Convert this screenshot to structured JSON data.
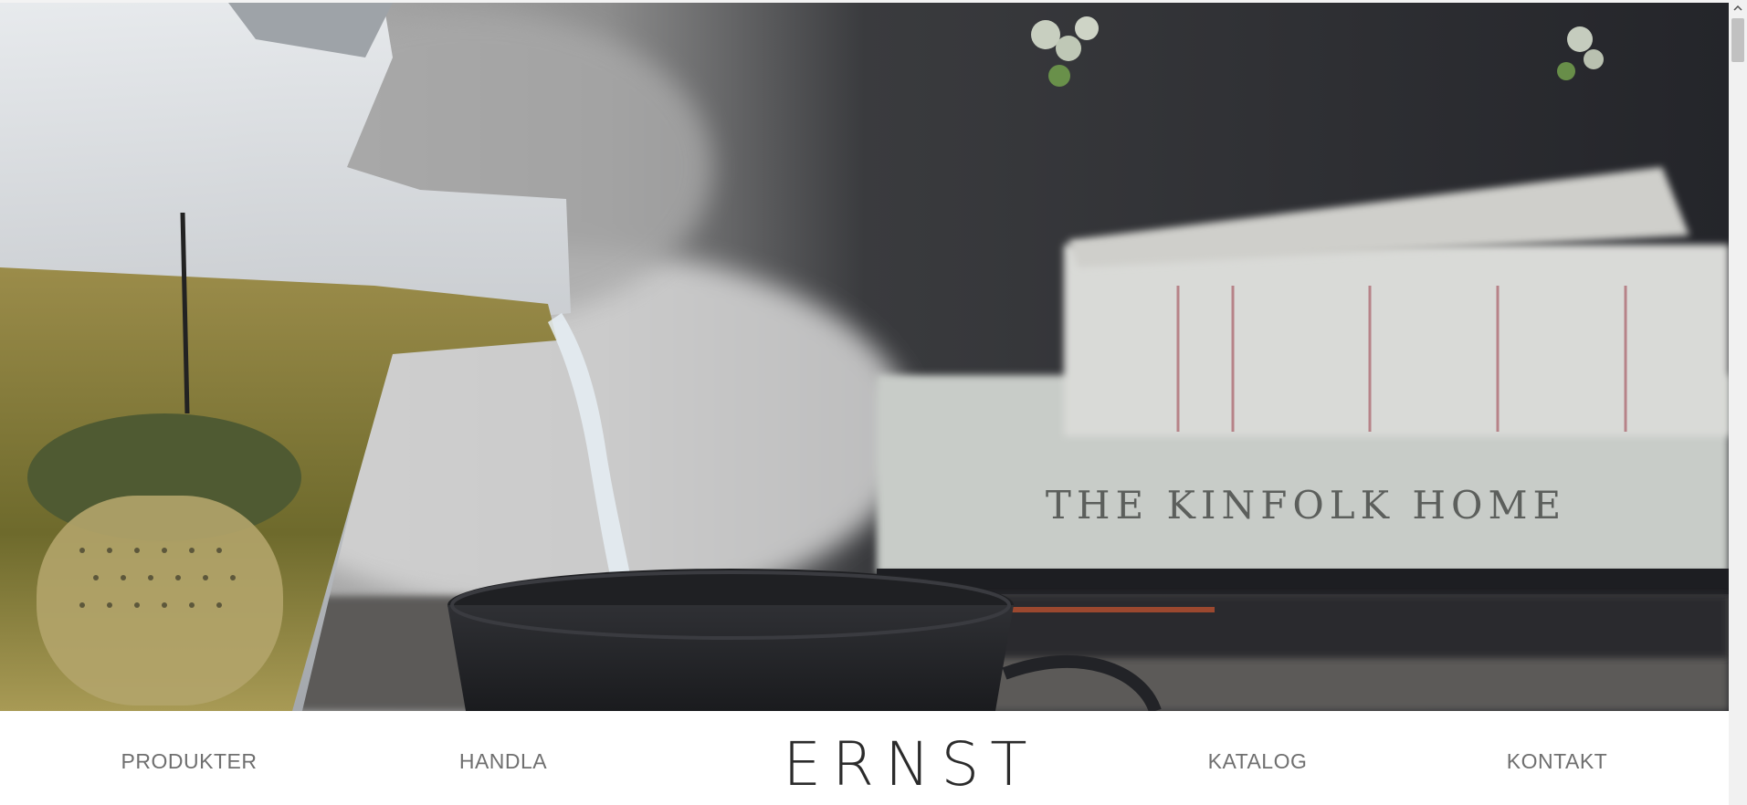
{
  "hero": {
    "book_spine_text": "THE KINFOLK HOME"
  },
  "nav": {
    "items": [
      {
        "label": "PRODUKTER"
      },
      {
        "label": "HANDLA"
      },
      {
        "label": "KATALOG"
      },
      {
        "label": "KONTAKT"
      }
    ],
    "brand": "ERNST"
  },
  "colors": {
    "nav_text": "#6f6f6f",
    "brand_text": "#2b2b2b",
    "background": "#ffffff"
  },
  "icons": {
    "scroll_up": "chevron-up-icon"
  }
}
